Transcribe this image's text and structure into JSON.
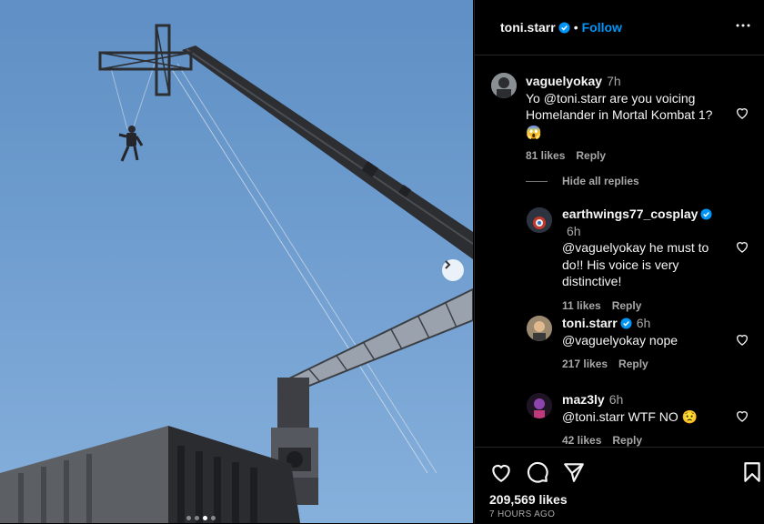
{
  "post": {
    "author": "toni.starr",
    "follow_label": "Follow",
    "separator": "•",
    "likes": "209,569 likes",
    "time_ago": "7 HOURS AGO",
    "carousel_count": 4,
    "carousel_active": 2
  },
  "comments": [
    {
      "user": "vaguelyokay",
      "time": "7h",
      "text": "Yo @toni.starr are you voicing Homelander in Mortal Kombat 1? 😱",
      "likes": "81 likes",
      "reply": "Reply"
    },
    {
      "user": "earthwings77_cosplay",
      "time": "6h",
      "text": "@vaguelyokay he must to do!! His voice is very distinctive!",
      "likes": "11 likes",
      "reply": "Reply"
    },
    {
      "user": "toni.starr",
      "time": "6h",
      "text": "@vaguelyokay nope",
      "likes": "217 likes",
      "reply": "Reply"
    },
    {
      "user": "maz3ly",
      "time": "6h",
      "text": "@toni.starr WTF NO 😟",
      "likes": "42 likes",
      "reply": "Reply"
    }
  ],
  "hide_replies_label": "Hide all replies",
  "colors": {
    "accent": "#0095f6",
    "verified": "#0095f6",
    "muted": "#a8a8a8",
    "background": "#000000"
  },
  "icons": [
    "heart-icon",
    "comment-icon",
    "share-icon",
    "bookmark-icon",
    "verified-icon",
    "more-icon",
    "chevron-right-icon"
  ]
}
